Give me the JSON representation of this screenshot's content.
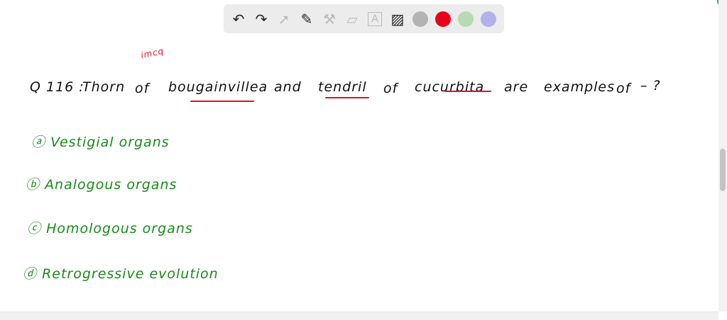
{
  "toolbar": {
    "tools": [
      "undo-icon",
      "redo-icon",
      "pointer-icon",
      "pen-icon",
      "tools-icon",
      "eraser-icon",
      "text-icon",
      "image-icon"
    ],
    "colors": [
      "#b3b3b3",
      "#e8001c",
      "#b7d9b3",
      "#b3b0ea"
    ]
  },
  "board": {
    "annotation": "imcq",
    "question": {
      "number": "Q 116 :",
      "parts": [
        "Thorn",
        "of",
        "bougainvillea",
        "and",
        "tendril",
        "of",
        "cucurbita",
        "are",
        "examples",
        "of",
        "– ?"
      ]
    },
    "options": [
      {
        "marker": "ⓐ",
        "text": "Vestigial organs"
      },
      {
        "marker": "ⓑ",
        "text": "Analogous organs"
      },
      {
        "marker": "ⓒ",
        "text": "Homologous organs"
      },
      {
        "marker": "ⓓ",
        "text": "Retrogressive evolution"
      }
    ]
  }
}
